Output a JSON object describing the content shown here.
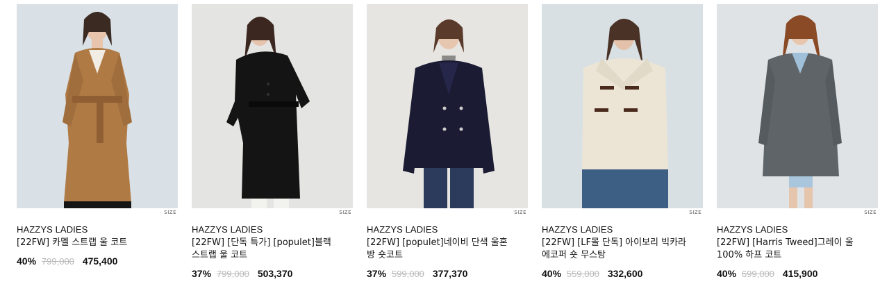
{
  "size_label": "SIZE",
  "products": [
    {
      "brand": "HAZZYS LADIES",
      "name": "[22FW] 카멜 스트랩 울 코트",
      "discount": "40%",
      "original_price": "799,000",
      "sale_price": "475,400",
      "coat_color": "#b07a45"
    },
    {
      "brand": "HAZZYS LADIES",
      "name": "[22FW] [단독 특가] [populet]블랙 스트랩 울 코트",
      "discount": "37%",
      "original_price": "799,000",
      "sale_price": "503,370",
      "coat_color": "#141414"
    },
    {
      "brand": "HAZZYS LADIES",
      "name": "[22FW] [populet]네이비 단색 울혼방 숏코트",
      "discount": "37%",
      "original_price": "599,000",
      "sale_price": "377,370",
      "coat_color": "#1b1c33"
    },
    {
      "brand": "HAZZYS LADIES",
      "name": "[22FW] [LF몰 단독] 아이보리 빅카라 에코퍼 숏 무스탕",
      "discount": "40%",
      "original_price": "559,000",
      "sale_price": "332,600",
      "coat_color": "#ece5d6"
    },
    {
      "brand": "HAZZYS LADIES",
      "name": "[22FW] [Harris Tweed]그레이 울 100% 하프 코트",
      "discount": "40%",
      "original_price": "699,000",
      "sale_price": "415,900",
      "coat_color": "#5e6468"
    }
  ]
}
